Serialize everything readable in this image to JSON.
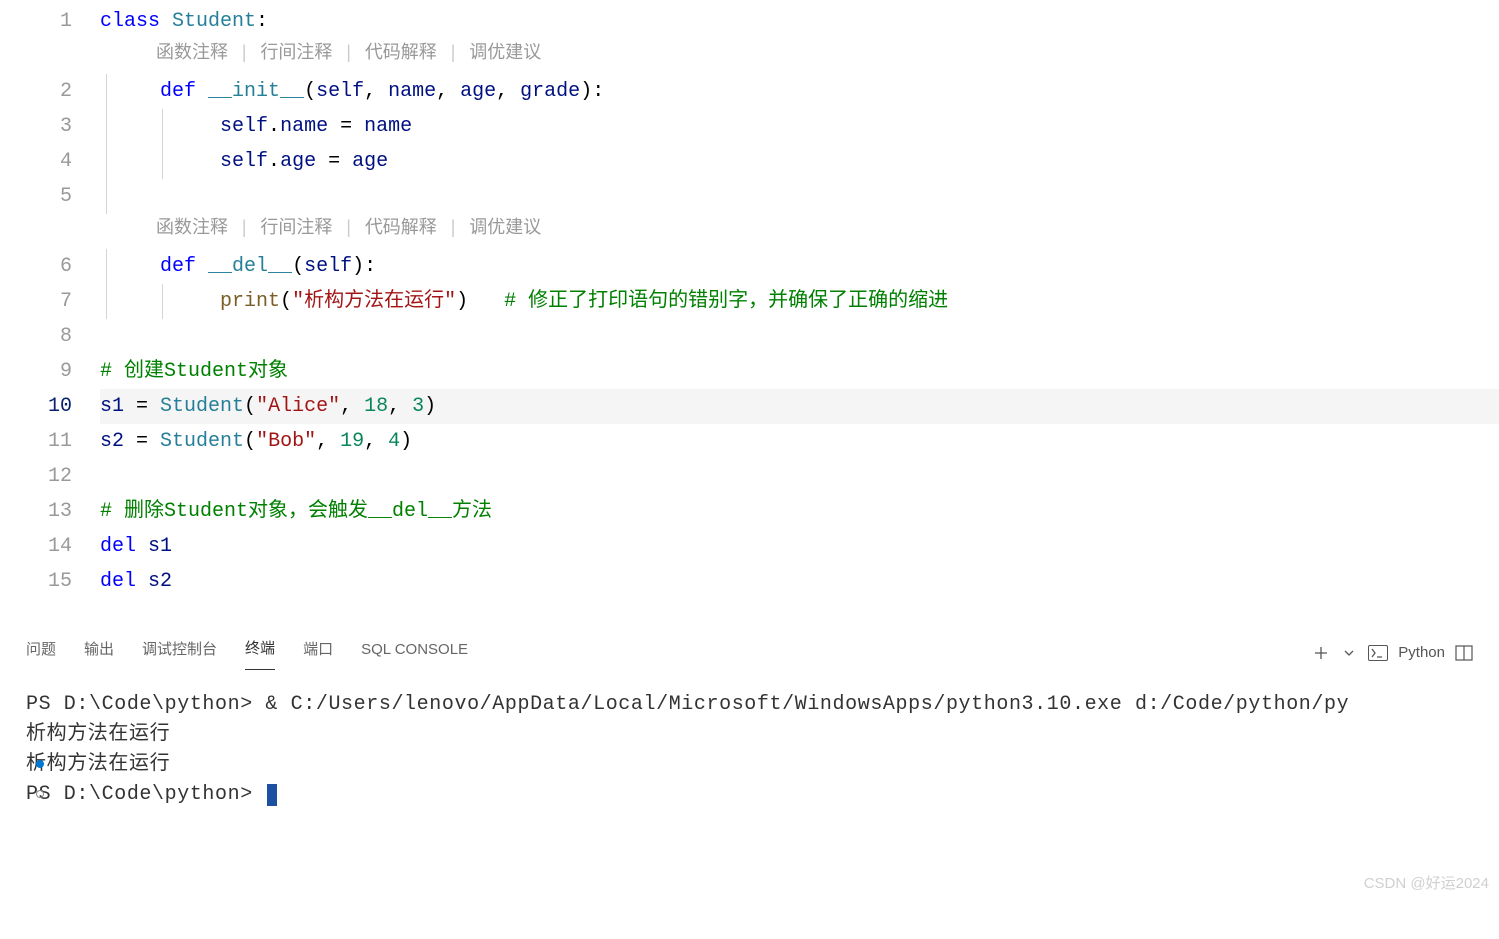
{
  "editor": {
    "line_numbers": [
      "1",
      "2",
      "3",
      "4",
      "5",
      "6",
      "7",
      "8",
      "9",
      "10",
      "11",
      "12",
      "13",
      "14",
      "15"
    ],
    "current_line": 10,
    "hints": {
      "items": [
        "函数注释",
        "行间注释",
        "代码解释",
        "调优建议"
      ]
    },
    "code": {
      "l1": {
        "kw_class": "class",
        "cls": "Student",
        "colon": ":"
      },
      "l2": {
        "kw_def": "def",
        "fn": "__init__",
        "lp": "(",
        "p_self": "self",
        "c1": ", ",
        "p_name": "name",
        "c2": ", ",
        "p_age": "age",
        "c3": ", ",
        "p_grade": "grade",
        "rp": ")",
        "colon": ":"
      },
      "l3": {
        "self": "self",
        "dot": ".",
        "attr": "name",
        "eq": " = ",
        "val": "name"
      },
      "l4": {
        "self": "self",
        "dot": ".",
        "attr": "age",
        "eq": " = ",
        "val": "age"
      },
      "l6": {
        "kw_def": "def",
        "fn": "__del__",
        "lp": "(",
        "p_self": "self",
        "rp": ")",
        "colon": ":"
      },
      "l7": {
        "fn": "print",
        "lp": "(",
        "str": "\"析构方法在运行\"",
        "rp": ")",
        "sp": "   ",
        "cmt": "# 修正了打印语句的错别字，并确保了正确的缩进"
      },
      "l9": {
        "cmt": "# 创建Student对象"
      },
      "l10": {
        "v": "s1",
        "eq": " = ",
        "cls": "Student",
        "lp": "(",
        "s": "\"Alice\"",
        "c1": ", ",
        "n1": "18",
        "c2": ", ",
        "n2": "3",
        "rp": ")"
      },
      "l11": {
        "v": "s2",
        "eq": " = ",
        "cls": "Student",
        "lp": "(",
        "s": "\"Bob\"",
        "c1": ", ",
        "n1": "19",
        "c2": ", ",
        "n2": "4",
        "rp": ")"
      },
      "l13": {
        "cmt": "# 删除Student对象，会触发__del__方法"
      },
      "l14": {
        "kw": "del",
        "sp": " ",
        "v": "s1"
      },
      "l15": {
        "kw": "del",
        "sp": " ",
        "v": "s2"
      }
    }
  },
  "panel": {
    "tabs": {
      "problems": "问题",
      "output": "输出",
      "debug": "调试控制台",
      "terminal": "终端",
      "ports": "端口",
      "sql": "SQL CONSOLE"
    },
    "active_tab": "terminal",
    "shell_label": "Python"
  },
  "terminal": {
    "lines": {
      "l1": "PS D:\\Code\\python> & C:/Users/lenovo/AppData/Local/Microsoft/WindowsApps/python3.10.exe d:/Code/python/py",
      "l2": "",
      "l3": "析构方法在运行",
      "l4": "析构方法在运行",
      "l5": "PS D:\\Code\\python> "
    }
  },
  "watermark": "CSDN @好运2024"
}
